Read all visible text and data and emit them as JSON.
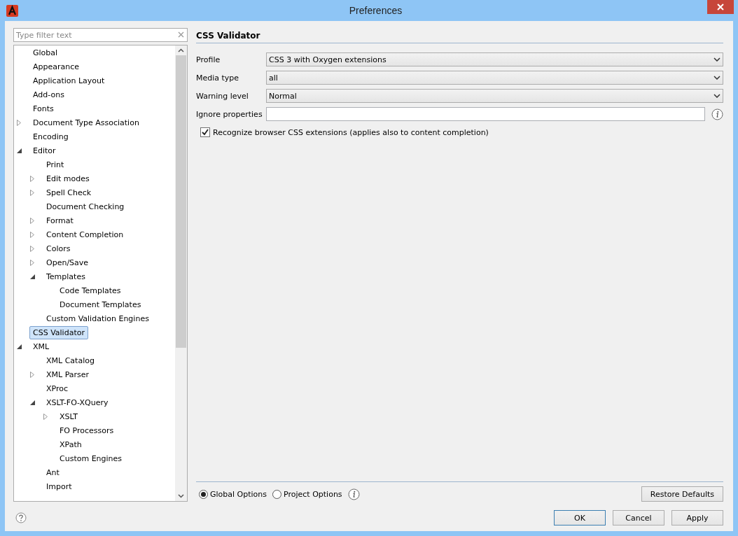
{
  "window": {
    "title": "Preferences"
  },
  "filter": {
    "placeholder": "Type filter text"
  },
  "tree": [
    {
      "label": "Global",
      "selected": false
    },
    {
      "label": "Appearance",
      "selected": false
    },
    {
      "label": "Application Layout",
      "selected": false
    },
    {
      "label": "Add-ons",
      "selected": false
    },
    {
      "label": "Fonts",
      "selected": false
    },
    {
      "label": "Document Type Association",
      "selected": false,
      "expanded": false
    },
    {
      "label": "Encoding",
      "selected": false
    },
    {
      "label": "Editor",
      "selected": false,
      "expanded": true,
      "children": [
        {
          "label": "Print",
          "selected": false
        },
        {
          "label": "Edit modes",
          "selected": false,
          "expanded": false
        },
        {
          "label": "Spell Check",
          "selected": false,
          "expanded": false
        },
        {
          "label": "Document Checking",
          "selected": false
        },
        {
          "label": "Format",
          "selected": false,
          "expanded": false
        },
        {
          "label": "Content Completion",
          "selected": false,
          "expanded": false
        },
        {
          "label": "Colors",
          "selected": false,
          "expanded": false
        },
        {
          "label": "Open/Save",
          "selected": false,
          "expanded": false
        },
        {
          "label": "Templates",
          "selected": false,
          "expanded": true,
          "children": [
            {
              "label": "Code Templates",
              "selected": false
            },
            {
              "label": "Document Templates",
              "selected": false
            }
          ]
        },
        {
          "label": "Custom Validation Engines",
          "selected": false
        }
      ]
    },
    {
      "label": "CSS Validator",
      "selected": true
    },
    {
      "label": "XML",
      "selected": false,
      "expanded": true,
      "children": [
        {
          "label": "XML Catalog",
          "selected": false
        },
        {
          "label": "XML Parser",
          "selected": false,
          "expanded": false
        },
        {
          "label": "XProc",
          "selected": false
        },
        {
          "label": "XSLT-FO-XQuery",
          "selected": false,
          "expanded": true,
          "children": [
            {
              "label": "XSLT",
              "selected": false,
              "expanded": false
            },
            {
              "label": "FO Processors",
              "selected": false
            },
            {
              "label": "XPath",
              "selected": false
            },
            {
              "label": "Custom Engines",
              "selected": false
            }
          ]
        },
        {
          "label": "Ant",
          "selected": false
        },
        {
          "label": "Import",
          "selected": false
        }
      ]
    }
  ],
  "page": {
    "title": "CSS Validator",
    "fields": [
      {
        "kind": "dropdown",
        "label": "Profile",
        "value": "CSS 3 with Oxygen extensions"
      },
      {
        "kind": "dropdown",
        "label": "Media type",
        "value": "all"
      },
      {
        "kind": "dropdown",
        "label": "Warning level",
        "value": "Normal"
      },
      {
        "kind": "text",
        "label": "Ignore properties"
      }
    ],
    "checkbox": {
      "label": "Recognize browser CSS extensions (applies also to content completion)",
      "checked": true
    }
  },
  "scope": [
    {
      "label": "Global Options",
      "selected": true
    },
    {
      "label": "Project Options",
      "selected": false
    }
  ],
  "restore_button": "Restore Defaults",
  "buttons": [
    {
      "label": "OK",
      "default": true
    },
    {
      "label": "Cancel",
      "default": false
    },
    {
      "label": "Apply",
      "default": false
    }
  ]
}
